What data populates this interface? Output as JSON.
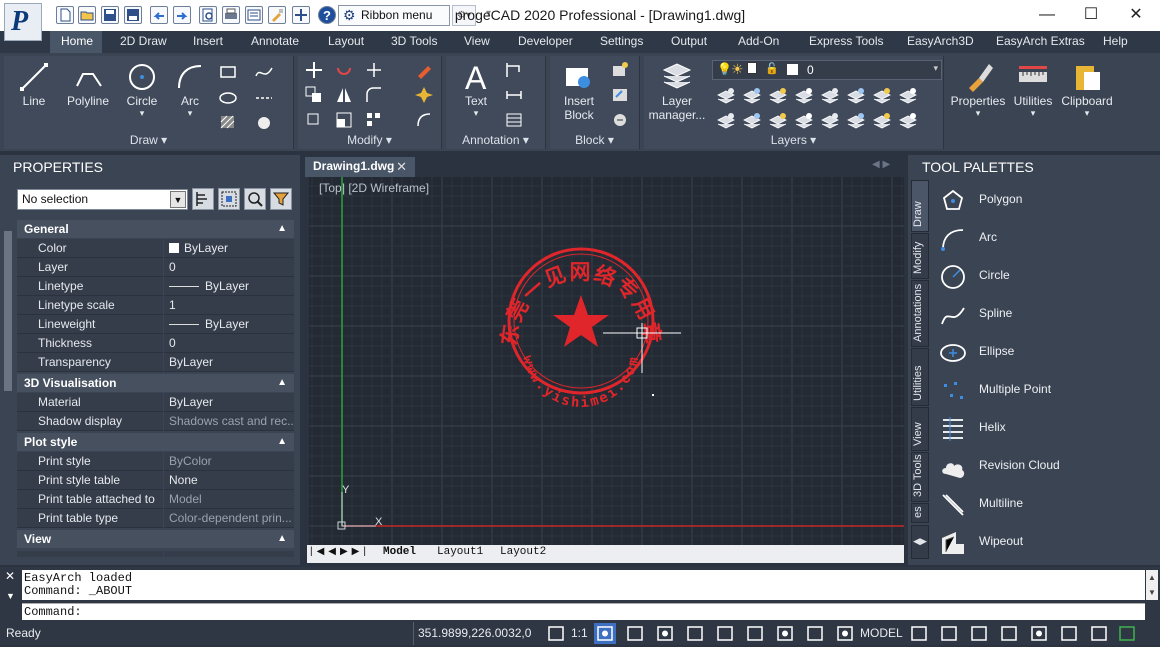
{
  "app": {
    "title": "progeCAD 2020 Professional - [Drawing1.dwg]",
    "logo_letter": "P"
  },
  "quick_access": {
    "ribbon_menu_label": "Ribbon menu"
  },
  "tabs": [
    "Home",
    "2D Draw",
    "Insert",
    "Annotate",
    "Layout",
    "3D Tools",
    "View",
    "Developer",
    "Settings",
    "Output",
    "Add-On",
    "Express Tools",
    "EasyArch3D",
    "EasyArch Extras",
    "Help"
  ],
  "ribbon": {
    "draw": {
      "title": "Draw",
      "buttons": [
        "Line",
        "Polyline",
        "Circle",
        "Arc"
      ]
    },
    "modify": {
      "title": "Modify"
    },
    "annotation": {
      "title": "Annotation",
      "text_label": "Text"
    },
    "block": {
      "title": "Block",
      "insert_label": "Insert",
      "insert_label2": "Block"
    },
    "layers": {
      "title": "Layers",
      "manager_label": "Layer",
      "manager_label2": "manager...",
      "current_layer": "0"
    },
    "properties_label": "Properties",
    "utilities_label": "Utilities",
    "clipboard_label": "Clipboard"
  },
  "properties": {
    "header": "PROPERTIES",
    "selection": "No selection",
    "sections": {
      "general": {
        "title": "General",
        "rows": [
          {
            "k": "Color",
            "v": "ByLayer"
          },
          {
            "k": "Layer",
            "v": "0"
          },
          {
            "k": "Linetype",
            "v": "ByLayer"
          },
          {
            "k": "Linetype scale",
            "v": "1"
          },
          {
            "k": "Lineweight",
            "v": "ByLayer"
          },
          {
            "k": "Thickness",
            "v": "0"
          },
          {
            "k": "Transparency",
            "v": "ByLayer"
          }
        ]
      },
      "vis": {
        "title": "3D Visualisation",
        "rows": [
          {
            "k": "Material",
            "v": "ByLayer"
          },
          {
            "k": "Shadow display",
            "v": "Shadows cast and rec..."
          }
        ]
      },
      "plot": {
        "title": "Plot style",
        "rows": [
          {
            "k": "Print style",
            "v": "ByColor"
          },
          {
            "k": "Print style table",
            "v": "None"
          },
          {
            "k": "Print table attached to",
            "v": "Model"
          },
          {
            "k": "Print table type",
            "v": "Color-dependent prin..."
          }
        ]
      },
      "view": {
        "title": "View"
      }
    }
  },
  "drawing": {
    "tab_label": "Drawing1.dwg",
    "view_label": "[Top] [2D Wireframe]",
    "axis_y": "Y",
    "axis_x": "X",
    "stamp_text": "东莞一见网络专用章",
    "stamp_url": "www.yishimei.com",
    "layout_tabs": [
      "Model",
      "Layout1",
      "Layout2"
    ]
  },
  "tool_palettes": {
    "header": "TOOL PALETTES",
    "side_tabs": [
      "Draw",
      "Modify",
      "Annotations",
      "Utilities",
      "View",
      "3D Tools",
      "es"
    ],
    "tools": [
      "Polygon",
      "Arc",
      "Circle",
      "Spline",
      "Ellipse",
      "Multiple Point",
      "Helix",
      "Revision Cloud",
      "Multiline",
      "Wipeout"
    ]
  },
  "command": {
    "history": [
      "EasyArch loaded",
      "Command: _ABOUT"
    ],
    "prompt": "Command:"
  },
  "status": {
    "ready": "Ready",
    "coords": "351.9899,226.0032,0",
    "scale": "1:1",
    "model": "MODEL"
  },
  "colors": {
    "accent": "#495668",
    "stamp": "#e0262b",
    "y_axis": "#27a43a",
    "x_axis": "#c62828"
  }
}
